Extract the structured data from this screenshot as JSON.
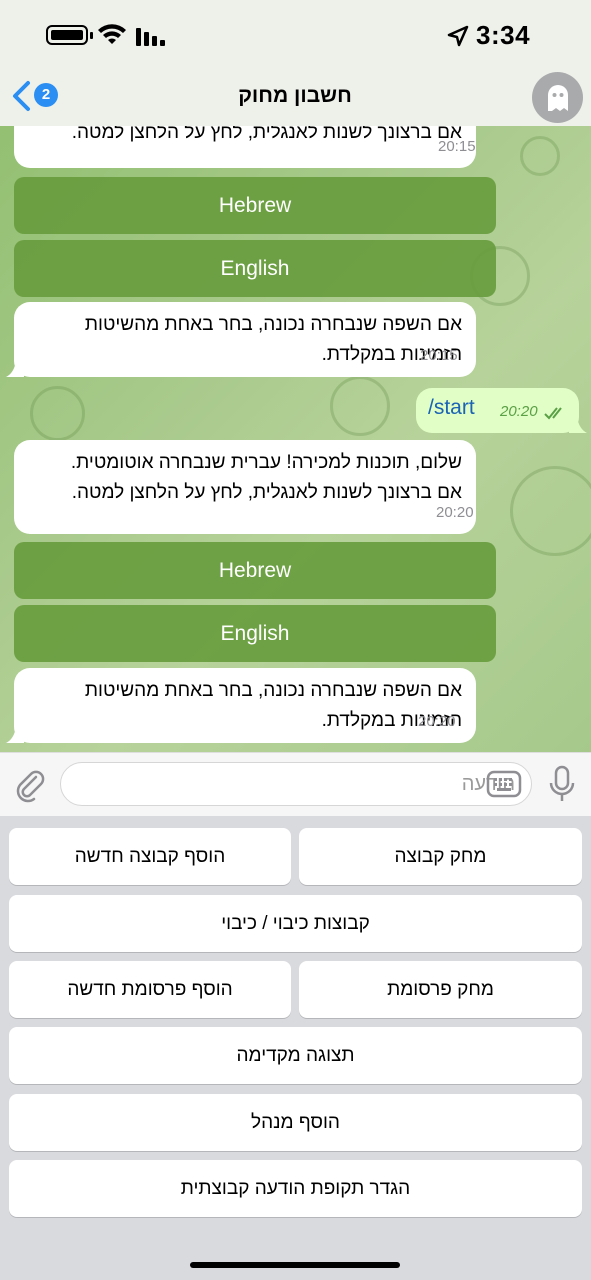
{
  "status_bar": {
    "time": "3:34"
  },
  "header": {
    "back_badge": "2",
    "title": "חשבון מחוק"
  },
  "messages": {
    "top_partial": {
      "text": "אם ברצונך לשנות לאנגלית, לחץ על הלחצן למטה.",
      "time": "20:15"
    },
    "buttons_1": {
      "hebrew": "Hebrew",
      "english": "English"
    },
    "confirm_1": {
      "line1": "אם השפה שנבחרה נכונה, בחר באחת מהשיטות",
      "line2": "הזמינות במקלדת.",
      "time": "20:15"
    },
    "outgoing": {
      "text": "/start",
      "time": "20:20"
    },
    "welcome": {
      "line1": "שלום, תוכנות למכירה! עברית שנבחרה אוטומטית.",
      "line2": "אם ברצונך לשנות לאנגלית, לחץ על הלחצן למטה.",
      "time": "20:20"
    },
    "buttons_2": {
      "hebrew": "Hebrew",
      "english": "English"
    },
    "confirm_2": {
      "line1": "אם השפה שנבחרה נכונה, בחר באחת מהשיטות",
      "line2": "הזמינות במקלדת.",
      "time": "20:20"
    }
  },
  "input": {
    "placeholder": "הודעה"
  },
  "keyboard": {
    "delete_group": "מחק קבוצה",
    "add_new_group": "הוסף קבוצה חדשה",
    "groups_on_off": "קבוצות כיבוי / כיבוי",
    "delete_post": "מחק פרסומת",
    "add_new_post": "הוסף פרסומת חדשה",
    "preview": "תצוגה מקדימה",
    "add_admin": "הוסף מנהל",
    "set_group_message_period": "הגדר תקופת הודעה קבוצתית"
  },
  "colors": {
    "accent": "#2b8ef2",
    "inline_button": "#6a9c3e",
    "outgoing_bubble": "#e1fec6",
    "chat_background": "#a7c98a"
  },
  "icons": [
    "battery-icon",
    "wifi-icon",
    "signal-icon",
    "location-arrow-icon",
    "back-chevron-icon",
    "ghost-icon",
    "paperclip-icon",
    "keyboard-icon",
    "microphone-icon",
    "double-check-icon"
  ]
}
